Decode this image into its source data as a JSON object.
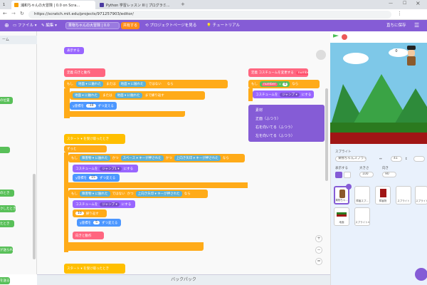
{
  "browser": {
    "tabs": [
      {
        "title": "浦和ちゃんの大冒険 | 0.0 on Scra...",
        "icon": "scratch-tab-icon"
      },
      {
        "title": "Python 学習レッスン III | プログラミ...",
        "icon": "python-tab-icon"
      }
    ],
    "leftover_tab": "1",
    "url": "https://scratch.mit.edu/projects/971257903/editor/"
  },
  "menubar": {
    "file": "ファイル",
    "edit": "編集",
    "project_title": "果物ちゃんの大冒険 | 0.0",
    "share": "共有する",
    "see_project": "プロジェクトページを見る",
    "tutorials": "チュートリアル",
    "save_now": "直ちに保存"
  },
  "palette": {
    "tab": "ーム",
    "blocks": [
      "の位置",
      "のとき",
      "クしたとき",
      "たとき",
      "が送られた",
      "を送る"
    ]
  },
  "scripts": {
    "top_stub": "表示する",
    "s1_hat": "定義 向きと動作",
    "s1_if": "もし",
    "s1_if_cond_a": "地面 ▾ に触れた",
    "s1_or": "または",
    "s1_if_cond_b": "地面 ▾ に触れた",
    "s1_not": "ではない",
    "s1_then": "なら",
    "s1_wait": "地面 ▾ に触れた",
    "s1_or2": "または",
    "s1_wait_b": "地面 ▾ に触れた",
    "s1_until": "まで繰り返す",
    "s1_change": "y座標を",
    "s1_change_val": "-10",
    "s1_change_tail": "ずつ変える",
    "s2_hat": "スタート ▾ を受け取ったとき",
    "s2_forever": "ずっと",
    "s2_if": "もし",
    "s2_cond_a": "障害物 ▾ に触れた",
    "s2_and": "かつ",
    "s2_key": "スペース ▾ キーが押された",
    "s2_and2": "かつ",
    "s2_key2": "上向き矢印 ▾ キーが押された",
    "s2_then": "なら",
    "s2_costume": "コスチュームを",
    "s2_costume_val": "ジャンプ1 ▾",
    "s2_costume_tail": "にする",
    "s2_change": "y座標を",
    "s2_change_val": "15",
    "s2_change_tail": "ずつ変える",
    "s2_if2": "もし",
    "s2_cond_b": "障害物 ▾ に触れた",
    "s2_not": "ではない",
    "s2_and3": "かつ",
    "s2_key3": "上向き矢印 ▾ キーが押された",
    "s2_then2": "なら",
    "s2_costume2": "コスチュームを",
    "s2_costume2_val": "ジャンプ ▾",
    "s2_costume2_tail": "にする",
    "s2_repeat": "繰り返す",
    "s2_repeat_val": "10",
    "s2_change2": "y座標を",
    "s2_change2_val": "5",
    "s2_change2_tail": "ずつ変える",
    "s2_call": "向きと動作",
    "s3_hat": "スタート ▾ を受け取ったとき",
    "r_hat": "定義 コスチュームを変更する",
    "r_hat_arg": "number",
    "r_if": "もし",
    "r_if_arg": "number",
    "r_eq": "=",
    "r_eq_val": "0",
    "r_then": "なら",
    "r_costume": "コスチュームを",
    "r_costume_val": "ジャンプ ▾",
    "r_costume_tail": "にする"
  },
  "dropdown": {
    "items": [
      "素材",
      "正面（ふつう）",
      "右を向いてる（ふつう）",
      "左を向いてる（ふつう）"
    ]
  },
  "backpack": "バックパック",
  "stage": {
    "score": "0",
    "sprite_label": "スプライト",
    "sprite_name": "果物ちゃんスプライ...",
    "x_label": "x",
    "x_value": "41",
    "y_label": "y",
    "y_value": "",
    "show_label": "表示する",
    "size_label": "大きさ",
    "size_value": "100",
    "dir_label": "向き",
    "dir_value": "90"
  },
  "sprites": [
    {
      "name": "果物ちゃ..."
    },
    {
      "name": "障害スプ..."
    },
    {
      "name": "障害物"
    },
    {
      "name": "スプライト"
    },
    {
      "name": "スプライト"
    },
    {
      "name": "地面"
    },
    {
      "name": "スプライト4"
    }
  ],
  "colors": {
    "menubar": "#855cd6",
    "events": "#ffbf00",
    "control": "#ffab19",
    "looks": "#9966ff",
    "operators": "#59c059",
    "sensing": "#5cb1d6",
    "my_blocks": "#ff6680"
  }
}
